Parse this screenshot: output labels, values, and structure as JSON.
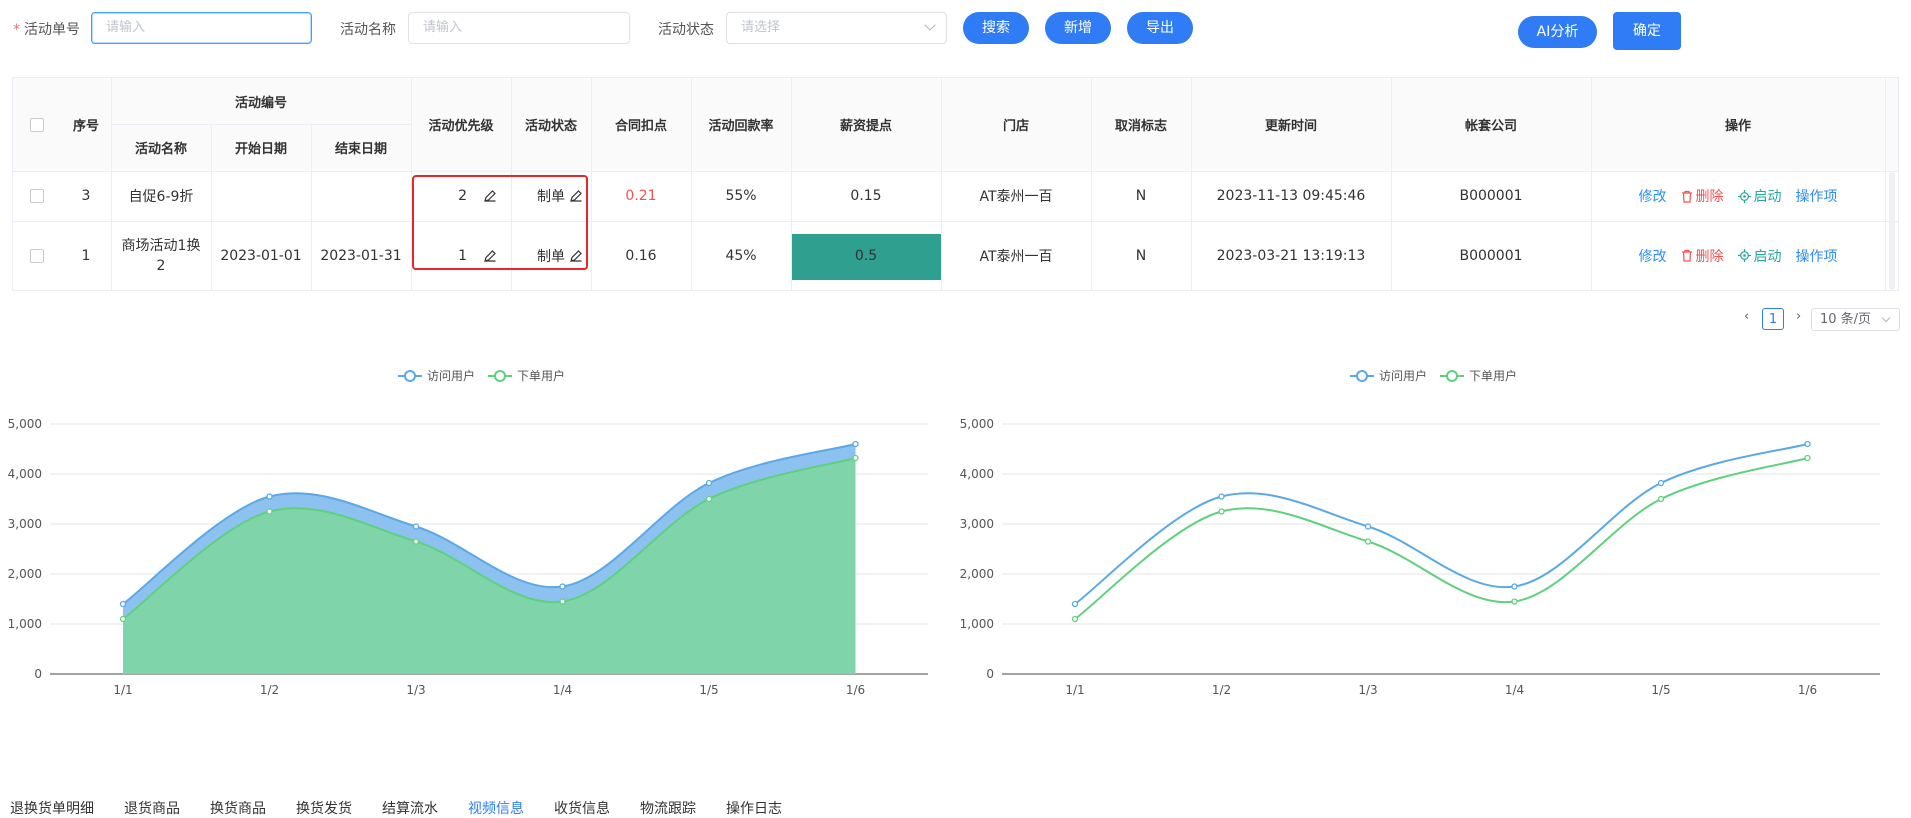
{
  "filters": {
    "activity_no_label": "活动单号",
    "activity_no_placeholder": "请输入",
    "activity_name_label": "活动名称",
    "activity_name_placeholder": "请输入",
    "activity_status_label": "活动状态",
    "activity_status_placeholder": "请选择",
    "search": "搜索",
    "add": "新增",
    "export": "导出",
    "ai": "AI分析",
    "confirm": "确定"
  },
  "table": {
    "headers": {
      "index": "序号",
      "activity_code": "活动编号",
      "activity_name": "活动名称",
      "start_date": "开始日期",
      "end_date": "结束日期",
      "priority": "活动优先级",
      "status": "活动状态",
      "discount": "合同扣点",
      "payback": "活动回款率",
      "salary": "薪资提点",
      "store": "门店",
      "cancel": "取消标志",
      "updated": "更新时间",
      "company": "帐套公司",
      "actions": "操作"
    },
    "rows": [
      {
        "index": "3",
        "name": "自促6-9折",
        "start": "",
        "end": "",
        "priority": "2",
        "status": "制单",
        "discount": "0.21",
        "payback": "55%",
        "salary": "0.15",
        "store": "AT泰州一百",
        "cancel": "N",
        "updated": "2023-11-13 09:45:46",
        "company": "B000001"
      },
      {
        "index": "1",
        "name": "商场活动1换2",
        "start": "2023-01-01",
        "end": "2023-01-31",
        "priority": "1",
        "status": "制单",
        "discount": "0.16",
        "payback": "45%",
        "salary": "0.5",
        "store": "AT泰州一百",
        "cancel": "N",
        "updated": "2023-03-21 13:19:13",
        "company": "B000001"
      }
    ],
    "actions": {
      "edit": "修改",
      "delete": "删除",
      "start": "启动",
      "more": "操作项"
    }
  },
  "pagination": {
    "current": "1",
    "page_size": "10 条/页"
  },
  "colors": {
    "primary": "#2f7cf6",
    "visit": "#5aa9e6",
    "order": "#5fd07e",
    "highlight": "#2fa08f",
    "red": "#f5504f"
  },
  "chart_data": [
    {
      "type": "area",
      "x": [
        "1/1",
        "1/2",
        "1/3",
        "1/4",
        "1/5",
        "1/6"
      ],
      "series": [
        {
          "name": "访问用户",
          "values": [
            1400,
            3550,
            2950,
            1750,
            3820,
            4600
          ]
        },
        {
          "name": "下单用户",
          "values": [
            1100,
            3250,
            2650,
            1450,
            3500,
            4320
          ]
        }
      ],
      "ylim": [
        0,
        5000
      ],
      "yticks": [
        "0",
        "1,000",
        "2,000",
        "3,000",
        "4,000",
        "5,000"
      ],
      "grid": true,
      "legend": "top-center"
    },
    {
      "type": "line",
      "x": [
        "1/1",
        "1/2",
        "1/3",
        "1/4",
        "1/5",
        "1/6"
      ],
      "series": [
        {
          "name": "访问用户",
          "values": [
            1400,
            3550,
            2950,
            1750,
            3820,
            4600
          ]
        },
        {
          "name": "下单用户",
          "values": [
            1100,
            3250,
            2650,
            1450,
            3500,
            4320
          ]
        }
      ],
      "ylim": [
        0,
        5000
      ],
      "yticks": [
        "0",
        "1,000",
        "2,000",
        "3,000",
        "4,000",
        "5,000"
      ],
      "grid": true,
      "legend": "top-center"
    }
  ],
  "bottom_tabs": [
    "退换货单明细",
    "退货商品",
    "换货商品",
    "换货发货",
    "结算流水",
    "视频信息",
    "收货信息",
    "物流跟踪",
    "操作日志"
  ],
  "bottom_tabs_active": 5
}
